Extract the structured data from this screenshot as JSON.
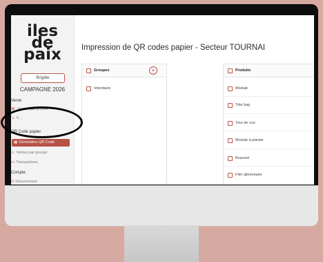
{
  "logo": {
    "line1": "iles",
    "line2": "de",
    "line3": "paix"
  },
  "user": {
    "name": "Brigitte"
  },
  "campaign": "CAMPAGNE 2026",
  "sidebar": {
    "sections": [
      {
        "title": "Vente"
      },
      {
        "title": "QR Code papier"
      },
      {
        "title": "Compte"
      }
    ],
    "items": [
      {
        "label": "Ventes par produit",
        "icon": "cart-icon"
      },
      {
        "label": "V...",
        "icon": "person-icon"
      },
      {
        "label": "Génération QR Code",
        "icon": "qr-icon"
      },
      {
        "label": "Ventes par groupe",
        "icon": "group-icon"
      },
      {
        "label": "Transactions",
        "icon": "card-icon"
      },
      {
        "label": "Déconnexion",
        "icon": "logout-icon"
      }
    ]
  },
  "main": {
    "title": "Impression de QR codes papier - Secteur TOURNAI"
  },
  "groups": {
    "header": "Groupes",
    "rows": [
      "Volontaire"
    ]
  },
  "products": {
    "header": "Produits",
    "rows": [
      "Module",
      "Tote bag",
      "Tour de cou",
      "Module à planter",
      "Bracelet",
      "Film alimentaire"
    ]
  },
  "colors": {
    "accent": "#b65346",
    "background": "#d6aaa1"
  }
}
